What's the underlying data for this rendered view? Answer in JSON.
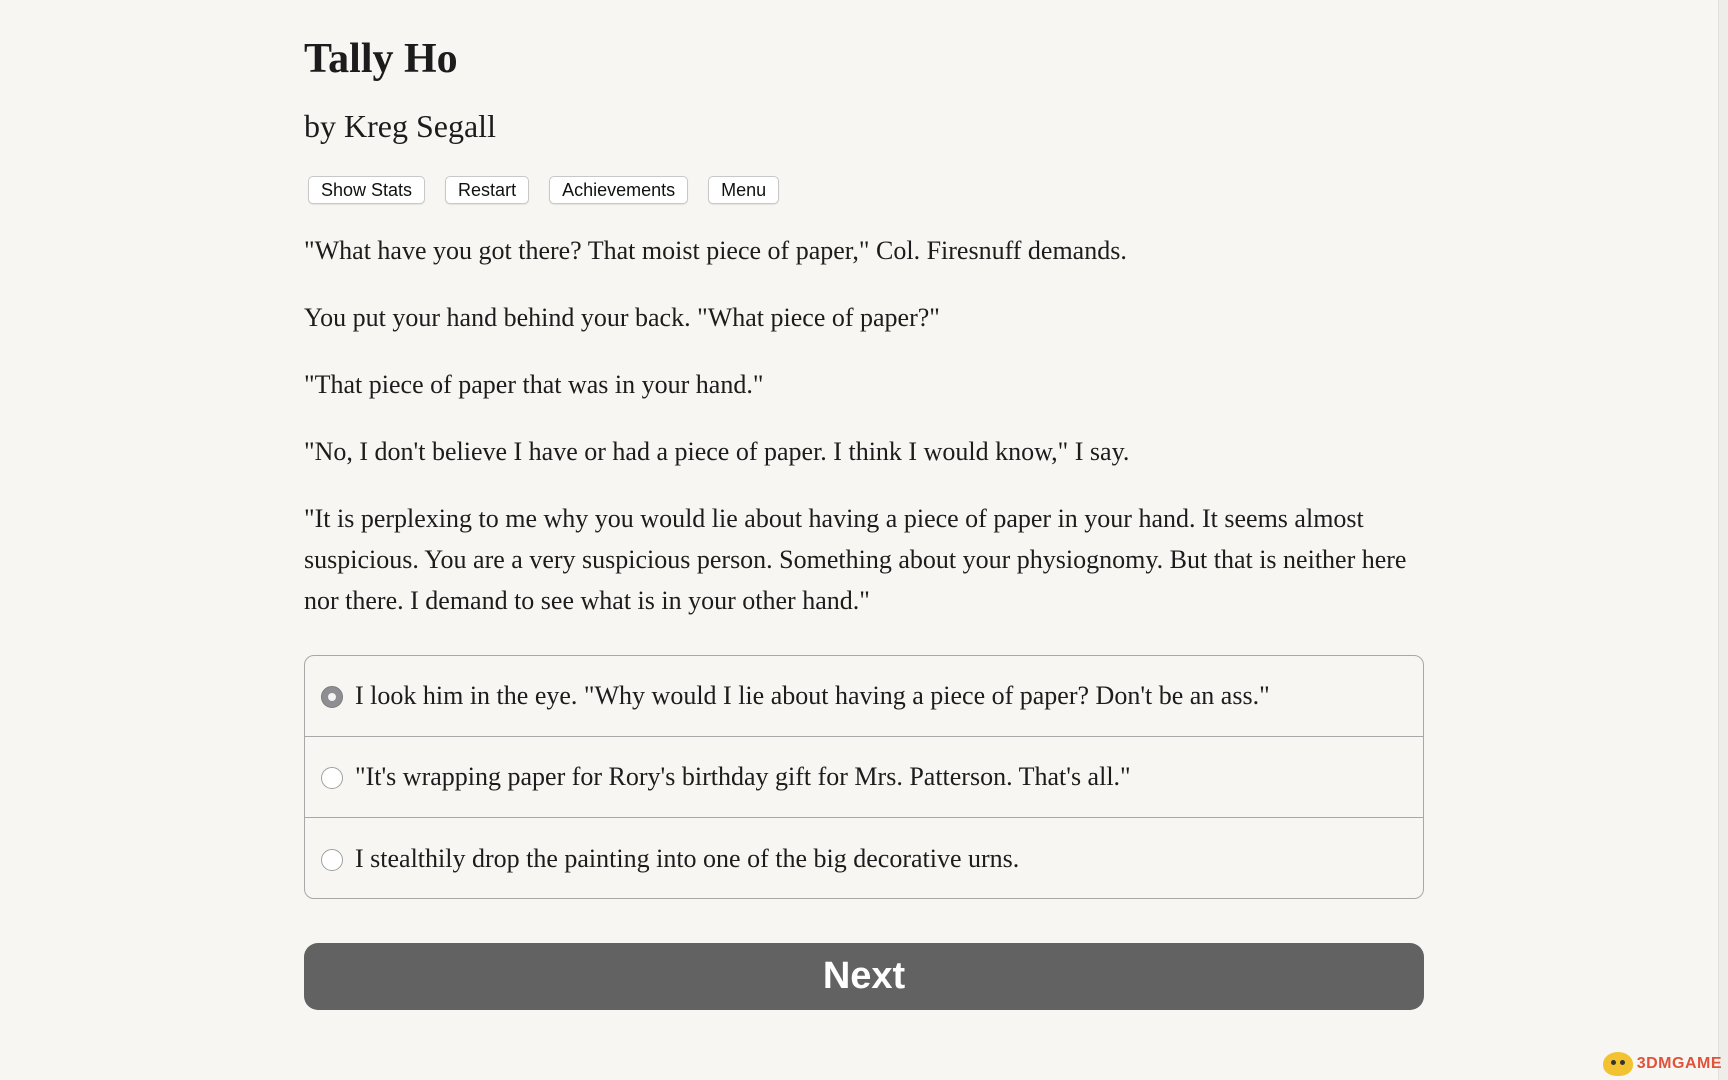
{
  "game": {
    "title": "Tally Ho",
    "author": "by Kreg Segall"
  },
  "toolbar": {
    "buttons": [
      {
        "label": "Show Stats"
      },
      {
        "label": "Restart"
      },
      {
        "label": "Achievements"
      },
      {
        "label": "Menu"
      }
    ]
  },
  "story": {
    "paragraphs": [
      "\"What have you got there? That moist piece of paper,\" Col. Firesnuff demands.",
      "You put your hand behind your back. \"What piece of paper?\"",
      "\"That piece of paper that was in your hand.\"",
      "\"No, I don't believe I have or had a piece of paper. I think I would know,\" I say.",
      "\"It is perplexing to me why you would lie about having a piece of paper in your hand. It seems almost suspicious. You are a very suspicious person. Something about your physiognomy. But that is neither here nor there. I demand to see what is in your other hand.\""
    ]
  },
  "choices": {
    "selected_index": 0,
    "options": [
      {
        "label": "I look him in the eye. \"Why would I lie about having a piece of paper? Don't be an ass.\""
      },
      {
        "label": "\"It's wrapping paper for Rory's birthday gift for Mrs. Patterson. That's all.\""
      },
      {
        "label": "I stealthily drop the painting into one of the big decorative urns."
      }
    ]
  },
  "next_button": {
    "label": "Next"
  },
  "watermark": {
    "text": "3DMGAME"
  },
  "colors": {
    "background": "#f8f6f3",
    "next_button": "#626262",
    "watermark_text": "#e0533a"
  }
}
